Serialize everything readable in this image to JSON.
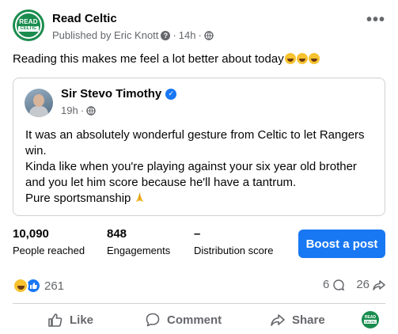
{
  "post": {
    "page_name": "Read Celtic",
    "published_by": "Published by Eric Knott",
    "time_ago": "14h",
    "text": "Reading this makes me feel a lot better about today",
    "logo_text_top": "READ",
    "logo_text_bottom": "CELTIC"
  },
  "shared_post": {
    "author": "Sir Stevo Timothy",
    "time_ago": "19h",
    "lines": [
      "It was an absolutely wonderful gesture from Celtic to let Rangers",
      "win.",
      "Kinda like when you're playing against your six year old brother",
      "and you let him score because he'll have a tantrum.",
      "Pure sportsmanship"
    ]
  },
  "insights": {
    "people_reached_value": "10,090",
    "people_reached_label": "People reached",
    "engagements_value": "848",
    "engagements_label": "Engagements",
    "distribution_value": "–",
    "distribution_label": "Distribution score",
    "boost_label": "Boost a post"
  },
  "reactions": {
    "count": "261",
    "comments": "6",
    "shares": "26"
  },
  "actions": {
    "like": "Like",
    "comment": "Comment",
    "share": "Share"
  },
  "colors": {
    "brand_green": "#1a8c4e",
    "facebook_blue": "#1877f2",
    "muted_text": "#65676b"
  }
}
